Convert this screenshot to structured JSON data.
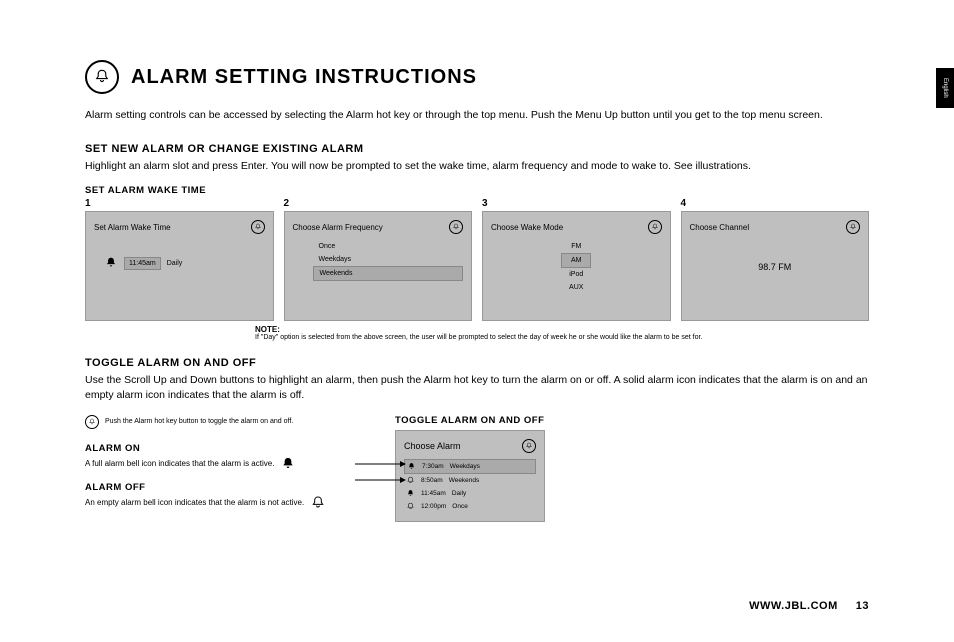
{
  "lang_tab": "English",
  "title": "ALARM SETTING INSTRUCTIONS",
  "intro": "Alarm setting controls can be accessed by selecting the Alarm hot key or through the top menu. Push the Menu Up button until you get to the top menu screen.",
  "section_new": {
    "heading": "SET NEW ALARM OR CHANGE EXISTING ALARM",
    "body": "Highlight an alarm slot and press Enter. You will now be prompted to set the wake time, alarm frequency and mode to wake to. See illustrations.",
    "subhead": "SET ALARM WAKE TIME"
  },
  "panels": [
    {
      "num": "1",
      "title": "Set Alarm Wake Time",
      "time": "11:45am",
      "freq": "Daily"
    },
    {
      "num": "2",
      "title": "Choose Alarm Frequency",
      "options": [
        "Once",
        "Weekdays",
        "Weekends"
      ],
      "selected": "Weekends"
    },
    {
      "num": "3",
      "title": "Choose Wake Mode",
      "options": [
        "FM",
        "AM",
        "iPod",
        "AUX"
      ],
      "selected": "AM"
    },
    {
      "num": "4",
      "title": "Choose Channel",
      "value": "98.7 FM"
    }
  ],
  "note": {
    "label": "NOTE:",
    "text": "If \"Day\" option is selected from the above screen, the user will be prompted to select the day of week he or she would like the alarm to be set for."
  },
  "section_toggle": {
    "heading": "TOGGLE ALARM ON AND OFF",
    "body": "Use the Scroll Up and Down buttons to highlight an alarm, then push the Alarm hot key to turn the alarm on or off. A solid alarm icon indicates that the alarm is on and an empty alarm icon indicates that the alarm is off."
  },
  "hint": "Push the Alarm hot key button to toggle the alarm on and off.",
  "alarm_on": {
    "heading": "ALARM ON",
    "text": "A full alarm bell icon indicates that the alarm is active."
  },
  "alarm_off": {
    "heading": "ALARM OFF",
    "text": "An empty alarm bell icon indicates that the alarm is not active."
  },
  "choose_panel": {
    "subhead": "TOGGLE ALARM ON AND OFF",
    "title": "Choose Alarm",
    "rows": [
      {
        "icon": "solid",
        "time": "7:30am",
        "freq": "Weekdays",
        "selected": true
      },
      {
        "icon": "outline",
        "time": "8:50am",
        "freq": "Weekends",
        "selected": false
      },
      {
        "icon": "solid",
        "time": "11:45am",
        "freq": "Daily",
        "selected": false
      },
      {
        "icon": "outline",
        "time": "12:00pm",
        "freq": "Once",
        "selected": false
      }
    ]
  },
  "footer": {
    "url": "WWW.JBL.COM",
    "page": "13"
  }
}
